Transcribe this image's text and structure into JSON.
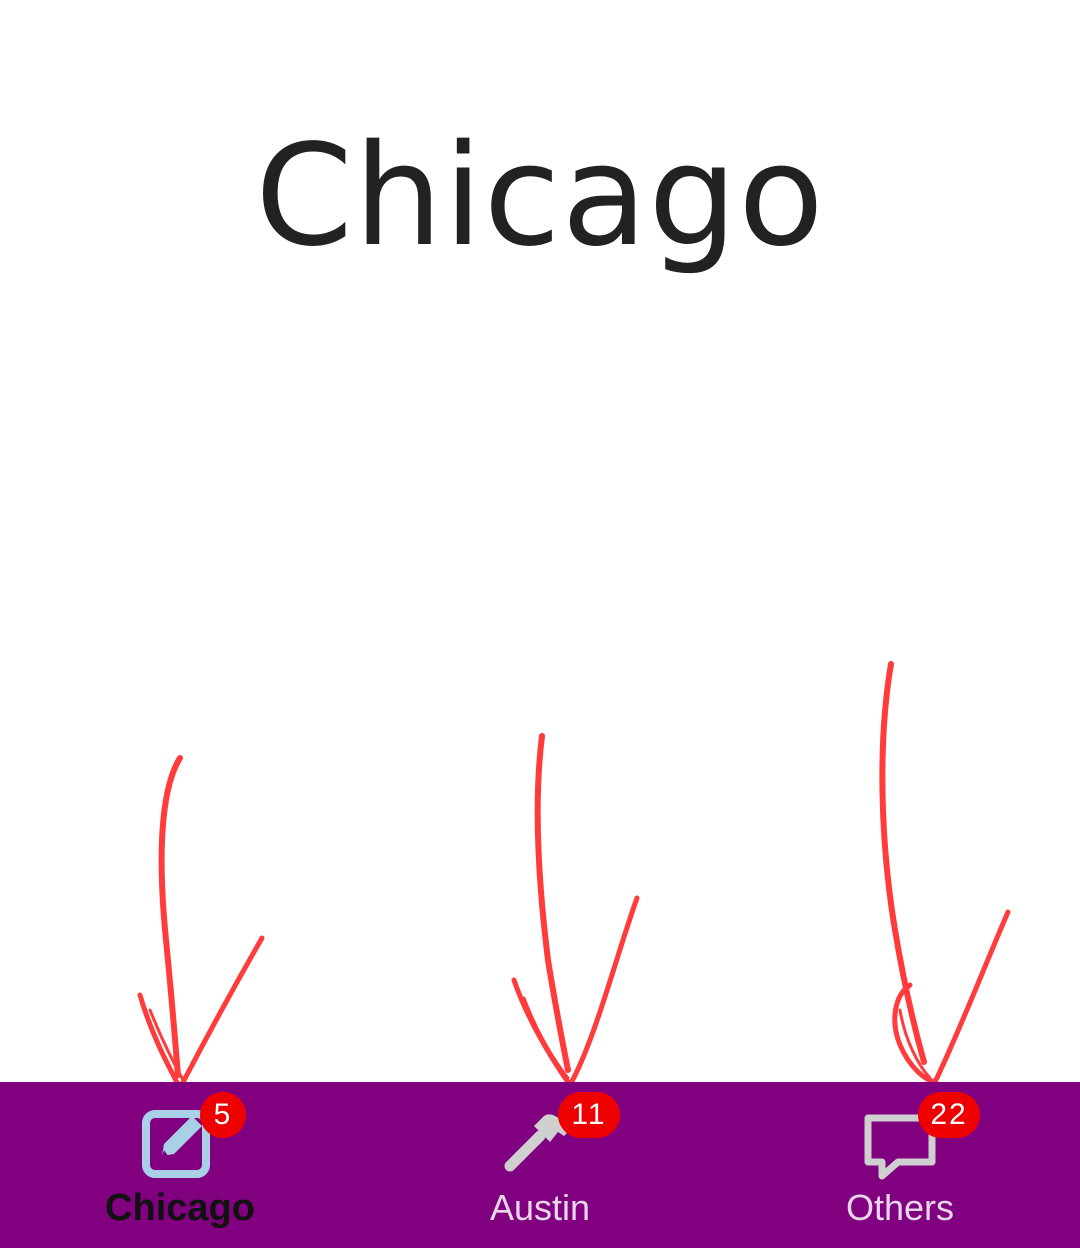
{
  "page": {
    "title": "Chicago"
  },
  "bottom_nav": {
    "background": "#800080",
    "active_index": 0,
    "items": [
      {
        "label": "Chicago",
        "icon": "edit-square-icon",
        "badge": "5",
        "active": true
      },
      {
        "label": "Austin",
        "icon": "hammer-icon",
        "badge": "11",
        "active": false
      },
      {
        "label": "Others",
        "icon": "chat-bubble-icon",
        "badge": "22",
        "active": false
      }
    ]
  },
  "colors": {
    "badge": "#ee0000",
    "annotation_arrow": "#ff3b3b",
    "active_icon": "#a8d0e6",
    "inactive_icon": "#cfcfcf"
  }
}
